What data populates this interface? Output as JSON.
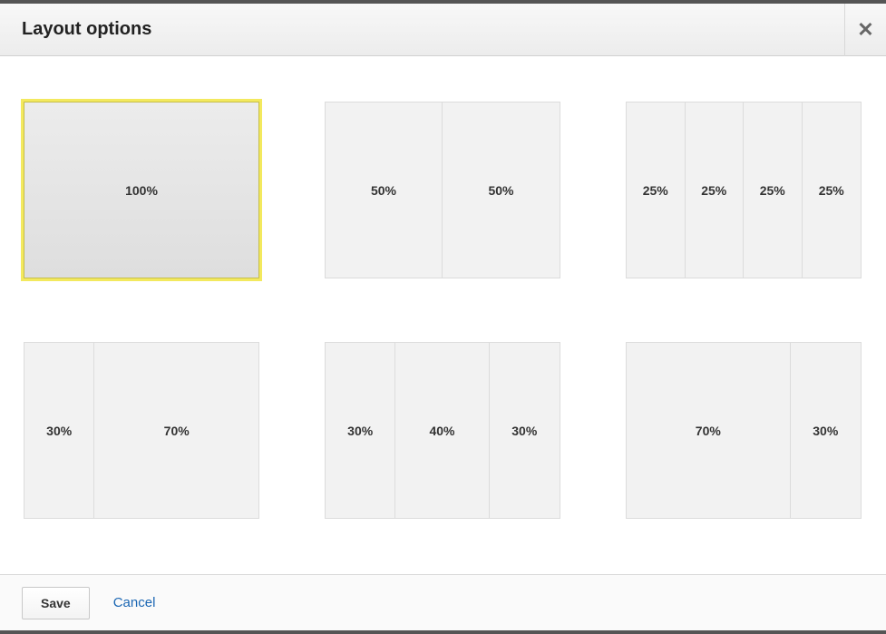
{
  "header": {
    "title": "Layout options",
    "close_icon": "✕"
  },
  "options": [
    {
      "selected": true,
      "cols": [
        {
          "pct": 100,
          "label": "100%"
        }
      ]
    },
    {
      "selected": false,
      "cols": [
        {
          "pct": 50,
          "label": "50%"
        },
        {
          "pct": 50,
          "label": "50%"
        }
      ]
    },
    {
      "selected": false,
      "cols": [
        {
          "pct": 25,
          "label": "25%"
        },
        {
          "pct": 25,
          "label": "25%"
        },
        {
          "pct": 25,
          "label": "25%"
        },
        {
          "pct": 25,
          "label": "25%"
        }
      ]
    },
    {
      "selected": false,
      "cols": [
        {
          "pct": 30,
          "label": "30%"
        },
        {
          "pct": 70,
          "label": "70%"
        }
      ]
    },
    {
      "selected": false,
      "cols": [
        {
          "pct": 30,
          "label": "30%"
        },
        {
          "pct": 40,
          "label": "40%"
        },
        {
          "pct": 30,
          "label": "30%"
        }
      ]
    },
    {
      "selected": false,
      "cols": [
        {
          "pct": 70,
          "label": "70%"
        },
        {
          "pct": 30,
          "label": "30%"
        }
      ]
    }
  ],
  "footer": {
    "save_label": "Save",
    "cancel_label": "Cancel"
  }
}
